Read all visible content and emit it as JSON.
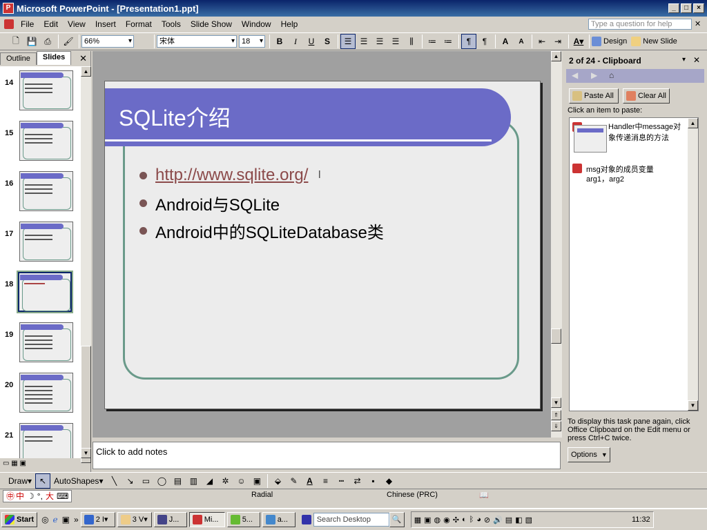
{
  "window": {
    "title": "Microsoft PowerPoint - [Presentation1.ppt]"
  },
  "menu": [
    "File",
    "Edit",
    "View",
    "Insert",
    "Format",
    "Tools",
    "Slide Show",
    "Window",
    "Help"
  ],
  "help_placeholder": "Type a question for help",
  "toolbar": {
    "zoom": "66%",
    "font": "宋体",
    "size": "18",
    "design": "Design",
    "new_slide": "New Slide"
  },
  "left_tabs": {
    "outline": "Outline",
    "slides": "Slides"
  },
  "thumbnails": [
    "14",
    "15",
    "16",
    "17",
    "18",
    "19",
    "20",
    "21"
  ],
  "selected_thumb": "18",
  "slide": {
    "title": "SQLite介绍",
    "bullets": [
      "http://www.sqlite.org/",
      "Android与SQLite",
      "Android中的SQLiteDatabase类"
    ],
    "colors": {
      "title_bar": "#6b6bc7",
      "frame": "#6a9a8a",
      "link": "#8b4a4a",
      "bullet": "#7a5555"
    }
  },
  "notes": "Click to add notes",
  "taskpane": {
    "title": "2 of 24 - Clipboard",
    "paste_all": "Paste All",
    "clear_all": "Clear All",
    "hint": "Click an item to paste:",
    "items": [
      {
        "text": "Handler中message对象传递消息的方法"
      },
      {
        "line1": "msg对象的成员变量",
        "line2": "arg1，arg2"
      }
    ],
    "footer": "To display this task pane again, click Office Clipboard on the Edit menu or press Ctrl+C twice.",
    "options": "Options"
  },
  "drawbar": {
    "draw": "Draw",
    "autoshapes": "AutoShapes"
  },
  "status": {
    "design": "Radial",
    "language": "Chinese (PRC)"
  },
  "taskbar": {
    "start": "Start",
    "search": "Search Desktop",
    "clock": "11:32",
    "buttons": [
      "2 I",
      "3 V",
      "J...",
      "Mi...",
      "5...",
      "a..."
    ]
  }
}
